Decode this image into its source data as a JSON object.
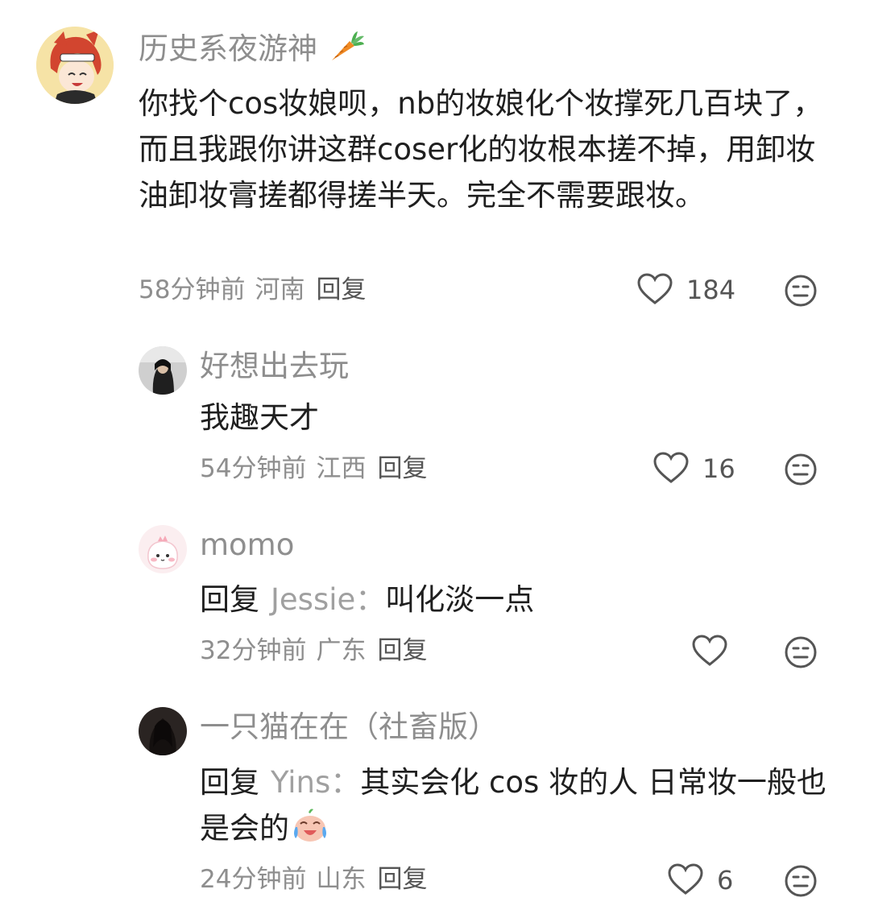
{
  "comments": [
    {
      "username": "历史系夜游神",
      "badge_icon": "carrot-icon",
      "text": "你找个cos妆娘呗，nb的妆娘化个妆撑死几百块了，而且我跟你讲这群coser化的妆根本搓不掉，用卸妆油卸妆膏搓都得搓半天。完全不需要跟妆。",
      "time": "58分钟前",
      "location": "河南",
      "reply_label": "回复",
      "likes": "184"
    },
    {
      "username": "好想出去玩",
      "text": "我趣天才",
      "time": "54分钟前",
      "location": "江西",
      "reply_label": "回复",
      "likes": "16"
    },
    {
      "username": "momo",
      "reply_prefix": "回复",
      "reply_target": "Jessie：",
      "text": "叫化淡一点",
      "time": "32分钟前",
      "location": "广东",
      "reply_label": "回复",
      "likes": ""
    },
    {
      "username": "一只猫在在（社畜版）",
      "reply_prefix": "回复",
      "reply_target": "Yins：",
      "text": "其实会化 cos 妆的人 日常妆一般也是会的",
      "emoji": "crying-laugh-emoji",
      "time": "24分钟前",
      "location": "山东",
      "reply_label": "回复",
      "likes": "6"
    }
  ],
  "icons": {
    "like": "heart-outline-icon",
    "dislike": "neutral-face-icon"
  },
  "colors": {
    "username": "#8e8e8e",
    "text": "#1f1f1f",
    "meta": "#8e8e8e"
  }
}
